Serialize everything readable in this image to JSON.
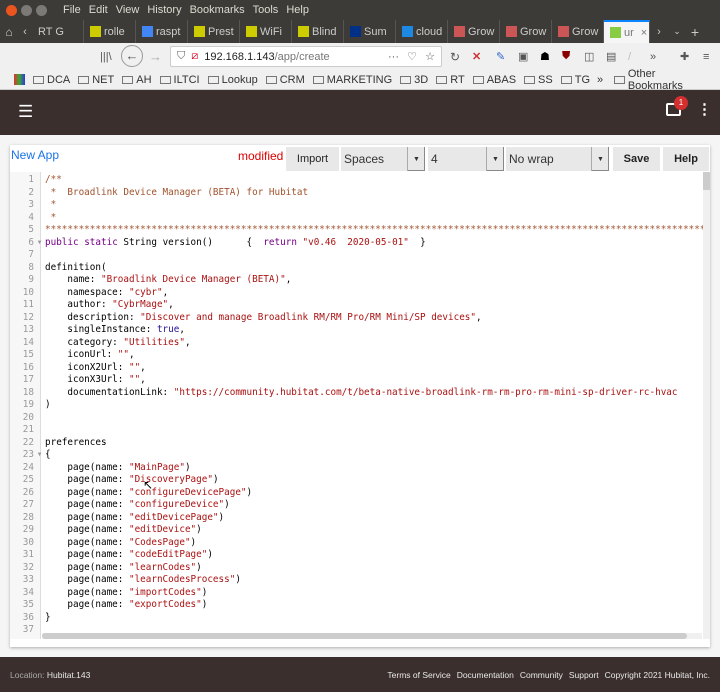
{
  "browser": {
    "menu": [
      "File",
      "Edit",
      "View",
      "History",
      "Bookmarks",
      "Tools",
      "Help"
    ],
    "tabs": [
      {
        "label": "RT G",
        "icon": "none"
      },
      {
        "label": "rolle",
        "icon": "iot-icon"
      },
      {
        "label": "raspt",
        "icon": "google-icon"
      },
      {
        "label": "Prest",
        "icon": "iot-icon"
      },
      {
        "label": "WiFi",
        "icon": "iot-icon"
      },
      {
        "label": "Blind",
        "icon": "iot-icon"
      },
      {
        "label": "Sum",
        "icon": "paypal-icon"
      },
      {
        "label": "cloud",
        "icon": "cloud-icon"
      },
      {
        "label": "Grow",
        "icon": "grow-icon"
      },
      {
        "label": "Grow",
        "icon": "grow-icon"
      },
      {
        "label": "Grow",
        "icon": "grow-icon"
      },
      {
        "label": "ur",
        "icon": "loading-icon",
        "active": true
      }
    ],
    "url_host": "192.168.1.143",
    "url_path": "/app/create",
    "bookmarks": [
      "DCA",
      "NET",
      "AH",
      "ILTCI",
      "Lookup",
      "CRM",
      "MARKETING",
      "3D",
      "RT",
      "ABAS",
      "SS",
      "TG"
    ],
    "other_bookmarks": "Other Bookmarks"
  },
  "header": {
    "notification_count": "1"
  },
  "editor": {
    "title": "New App",
    "status": "modified",
    "import_label": "Import",
    "indent_type": "Spaces",
    "indent_size": "4",
    "wrap": "No wrap",
    "save_label": "Save",
    "help_label": "Help",
    "lines": [
      [
        [
          "c",
          "/**"
        ]
      ],
      [
        [
          "c",
          " *  Broadlink Device Manager (BETA) for Hubitat"
        ]
      ],
      [
        [
          "c",
          " *"
        ]
      ],
      [
        [
          "c",
          " *"
        ]
      ],
      [
        [
          "c",
          "**************************************************************************************************************************"
        ]
      ],
      [
        [
          "k",
          "public"
        ],
        [
          "p",
          " "
        ],
        [
          "k",
          "static"
        ],
        [
          "p",
          " String version()      {  "
        ],
        [
          "k",
          "return"
        ],
        [
          "p",
          " "
        ],
        [
          "s",
          "\"v0.46  2020-05-01\""
        ],
        [
          "p",
          "  }"
        ]
      ],
      [],
      [
        [
          "p",
          "definition("
        ]
      ],
      [
        [
          "p",
          "    name: "
        ],
        [
          "s",
          "\"Broadlink Device Manager (BETA)\""
        ],
        [
          "p",
          ","
        ]
      ],
      [
        [
          "p",
          "    namespace: "
        ],
        [
          "s",
          "\"cybr\""
        ],
        [
          "p",
          ","
        ]
      ],
      [
        [
          "p",
          "    author: "
        ],
        [
          "s",
          "\"CybrMage\""
        ],
        [
          "p",
          ","
        ]
      ],
      [
        [
          "p",
          "    description: "
        ],
        [
          "s",
          "\"Discover and manage Broadlink RM/RM Pro/RM Mini/SP devices\""
        ],
        [
          "p",
          ","
        ]
      ],
      [
        [
          "p",
          "    singleInstance: "
        ],
        [
          "a",
          "true"
        ],
        [
          "p",
          ","
        ]
      ],
      [
        [
          "p",
          "    category: "
        ],
        [
          "s",
          "\"Utilities\""
        ],
        [
          "p",
          ","
        ]
      ],
      [
        [
          "p",
          "    iconUrl: "
        ],
        [
          "s",
          "\"\""
        ],
        [
          "p",
          ","
        ]
      ],
      [
        [
          "p",
          "    iconX2Url: "
        ],
        [
          "s",
          "\"\""
        ],
        [
          "p",
          ","
        ]
      ],
      [
        [
          "p",
          "    iconX3Url: "
        ],
        [
          "s",
          "\"\""
        ],
        [
          "p",
          ","
        ]
      ],
      [
        [
          "p",
          "    documentationLink: "
        ],
        [
          "s",
          "\"https://community.hubitat.com/t/beta-native-broadlink-rm-rm-pro-rm-mini-sp-driver-rc-hvac"
        ]
      ],
      [
        [
          "p",
          ")"
        ]
      ],
      [],
      [],
      [
        [
          "p",
          "preferences"
        ]
      ],
      [
        [
          "p",
          "{"
        ]
      ],
      [
        [
          "p",
          "    page(name: "
        ],
        [
          "s",
          "\"MainPage\""
        ],
        [
          "p",
          ")"
        ]
      ],
      [
        [
          "p",
          "    page(name: "
        ],
        [
          "s",
          "\"DiscoveryPage\""
        ],
        [
          "p",
          ")"
        ]
      ],
      [
        [
          "p",
          "    page(name: "
        ],
        [
          "s",
          "\"configureDevicePage\""
        ],
        [
          "p",
          ")"
        ]
      ],
      [
        [
          "p",
          "    page(name: "
        ],
        [
          "s",
          "\"configureDevice\""
        ],
        [
          "p",
          ")"
        ]
      ],
      [
        [
          "p",
          "    page(name: "
        ],
        [
          "s",
          "\"editDevicePage\""
        ],
        [
          "p",
          ")"
        ]
      ],
      [
        [
          "p",
          "    page(name: "
        ],
        [
          "s",
          "\"editDevice\""
        ],
        [
          "p",
          ")"
        ]
      ],
      [
        [
          "p",
          "    page(name: "
        ],
        [
          "s",
          "\"CodesPage\""
        ],
        [
          "p",
          ")"
        ]
      ],
      [
        [
          "p",
          "    page(name: "
        ],
        [
          "s",
          "\"codeEditPage\""
        ],
        [
          "p",
          ")"
        ]
      ],
      [
        [
          "p",
          "    page(name: "
        ],
        [
          "s",
          "\"learnCodes\""
        ],
        [
          "p",
          ")"
        ]
      ],
      [
        [
          "p",
          "    page(name: "
        ],
        [
          "s",
          "\"learnCodesProcess\""
        ],
        [
          "p",
          ")"
        ]
      ],
      [
        [
          "p",
          "    page(name: "
        ],
        [
          "s",
          "\"importCodes\""
        ],
        [
          "p",
          ")"
        ]
      ],
      [
        [
          "p",
          "    page(name: "
        ],
        [
          "s",
          "\"exportCodes\""
        ],
        [
          "p",
          ")"
        ]
      ],
      [
        [
          "p",
          "}"
        ]
      ],
      []
    ],
    "foldable_lines": [
      6,
      23
    ]
  },
  "footer": {
    "location_label": "Location:",
    "location_value": "Hubitat.143",
    "links": [
      "Terms of Service",
      "Documentation",
      "Community",
      "Support"
    ],
    "copyright": "Copyright 2021 Hubitat, Inc."
  },
  "colors": {
    "header_bg": "#3a2f2d",
    "title_link": "#1a73e8",
    "modified": "#e00000",
    "badge": "#d32f2f"
  }
}
